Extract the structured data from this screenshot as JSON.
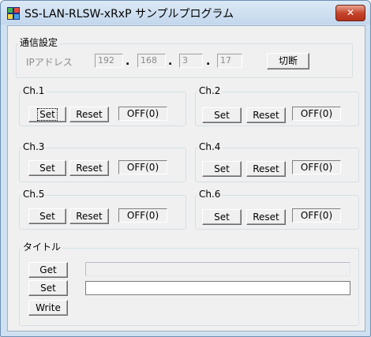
{
  "window": {
    "title": "SS-LAN-RLSW-xRxP サンプルプログラム",
    "close_glyph": "✕"
  },
  "network": {
    "group_label": "通信設定",
    "ip_label": "IPアドレス",
    "ip_octets": [
      "192",
      "168",
      "3",
      "17"
    ],
    "dot": ".",
    "disconnect_label": "切断"
  },
  "channels": [
    {
      "label": "Ch.1",
      "set": "Set",
      "reset": "Reset",
      "state": "OFF(0)"
    },
    {
      "label": "Ch.2",
      "set": "Set",
      "reset": "Reset",
      "state": "OFF(0)"
    },
    {
      "label": "Ch.3",
      "set": "Set",
      "reset": "Reset",
      "state": "OFF(0)"
    },
    {
      "label": "Ch.4",
      "set": "Set",
      "reset": "Reset",
      "state": "OFF(0)"
    },
    {
      "label": "Ch.5",
      "set": "Set",
      "reset": "Reset",
      "state": "OFF(0)"
    },
    {
      "label": "Ch.6",
      "set": "Set",
      "reset": "Reset",
      "state": "OFF(0)"
    }
  ],
  "title_group": {
    "label": "タイトル",
    "get_label": "Get",
    "set_label": "Set",
    "write_label": "Write",
    "get_value": "",
    "set_value": ""
  },
  "colors": {
    "titlebar": "#c3d7ec",
    "close_button": "#c6452c",
    "dialog_face": "#f0f0f0"
  }
}
